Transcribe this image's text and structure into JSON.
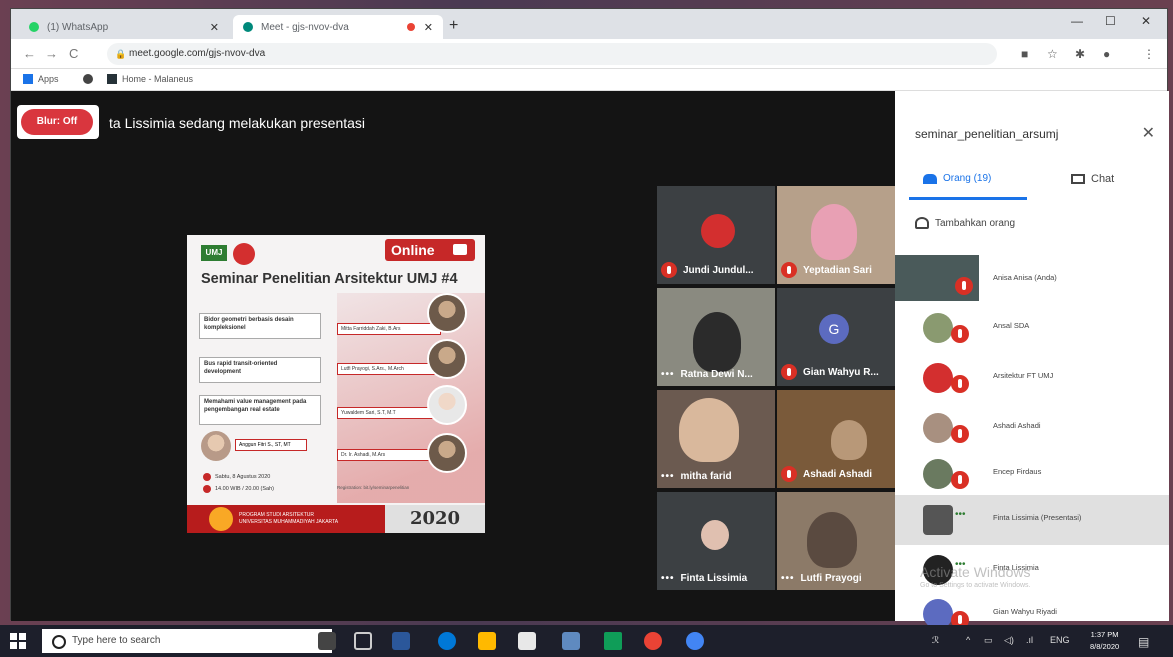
{
  "browser": {
    "tabs": [
      {
        "label": "(1) WhatsApp"
      },
      {
        "label": "Meet - gjs-nvov-dva"
      }
    ],
    "url": "meet.google.com/gjs-nvov-dva",
    "bookmarks": [
      {
        "label": "Apps"
      },
      {
        "label": "Home - Malaneus"
      }
    ]
  },
  "meet": {
    "blur_label": "Blur: Off",
    "presenter_banner": "ta Lissimia sedang melakukan presentasi",
    "poster": {
      "logo": "UMJ",
      "online": "Online",
      "title": "Seminar Penelitian Arsitektur UMJ #4",
      "topics": [
        "Bidor geometri berbasis desain kompleksionel",
        "Bus rapid transit-oriented development",
        "Memahami value management pada pengembangan real estate"
      ],
      "speakers": [
        "Mitta Farriddah Zaki, B.Ars",
        "Lutfi Prayogi, S.Ars., M.Arch",
        "Yuwaldem Sari, S.T, M.T",
        "Dr. Ir. Ashadi, M.Ars"
      ],
      "moderator": "Anggun Fitri S., ST, MT",
      "date": "Sabtu, 8 Agustus 2020",
      "time": "14.00 WIB / 20.00 (Sah)",
      "register": "Registration: bit.ly/seminarpenelitian",
      "program": [
        "PROGRAM STUDI ARSITEKTUR",
        "UNIVERSITAS MUHAMMADIYAH JAKARTA"
      ],
      "year": "2020"
    },
    "tiles": [
      {
        "name": "Jundi Jundul...",
        "muted": true
      },
      {
        "name": "Yeptadian Sari",
        "muted": true
      },
      {
        "name": "Ratna Dewi N...",
        "muted": false
      },
      {
        "name": "Gian Wahyu R...",
        "muted": true,
        "letter": "G"
      },
      {
        "name": "mitha farid",
        "muted": false
      },
      {
        "name": "Ashadi Ashadi",
        "muted": true
      },
      {
        "name": "Finta Lissimia",
        "muted": false
      },
      {
        "name": "Lutfi Prayogi",
        "muted": false
      }
    ]
  },
  "panel": {
    "title": "seminar_penelitian_arsumj",
    "tab_people": "Orang (19)",
    "tab_chat": "Chat",
    "add_people": "Tambahkan orang",
    "participants": [
      {
        "name": "Anisa Anisa (Anda)"
      },
      {
        "name": "Ansal SDA"
      },
      {
        "name": "Arsitektur FT UMJ"
      },
      {
        "name": "Ashadi Ashadi"
      },
      {
        "name": "Encep Firdaus"
      },
      {
        "name": "Finta Lissimia (Presentasi)"
      },
      {
        "name": "Finta Lissimia"
      },
      {
        "name": "Gian Wahyu Riyadi"
      }
    ],
    "watermark": "Activate Windows",
    "watermark_sub": "Go to Settings to activate Windows."
  },
  "taskbar": {
    "search_placeholder": "Type here to search",
    "time": "1:37 PM",
    "date": "8/8/2020",
    "lang": "ENG"
  },
  "colors": {
    "accent": "#1a73e8",
    "mute": "#d93025",
    "blur": "#d9363e"
  }
}
